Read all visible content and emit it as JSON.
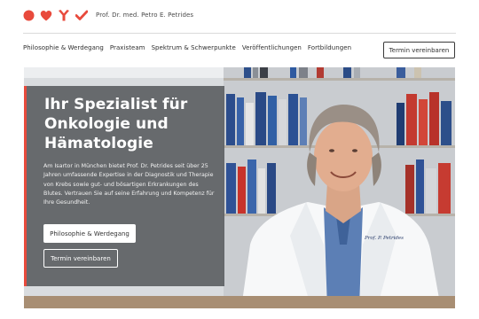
{
  "header": {
    "brand_name": "Prof. Dr. med. Petro E. Petrides",
    "logo_icons": [
      "circle-icon",
      "heart-icon",
      "antibody-icon",
      "checkmark-icon"
    ],
    "colors": {
      "accent": "#e84a3c",
      "text": "#2b2b2b"
    }
  },
  "nav": {
    "items": [
      {
        "label": "Philosophie & Werdegang"
      },
      {
        "label": "Praxisteam"
      },
      {
        "label": "Spektrum & Schwerpunkte"
      },
      {
        "label": "Veröffentlichungen"
      },
      {
        "label": "Fortbildungen"
      }
    ],
    "cta_label": "Termin vereinbaren"
  },
  "hero": {
    "title": "Ihr Spezialist für Onkologie und Hämatologie",
    "text": "Am Isartor in München bietet Prof. Dr. Petrides seit über 25 Jahren umfassende Expertise in der Diagnostik und Therapie von Krebs sowie gut- und bösartigen Erkrankungen des Blutes. Vertrauen Sie auf seine Erfahrung und Kompetenz für Ihre Gesundheit.",
    "primary_button": "Philosophie & Werdegang",
    "secondary_button": "Termin vereinbaren",
    "coat_embroidery": "Prof. P. Petrides"
  }
}
